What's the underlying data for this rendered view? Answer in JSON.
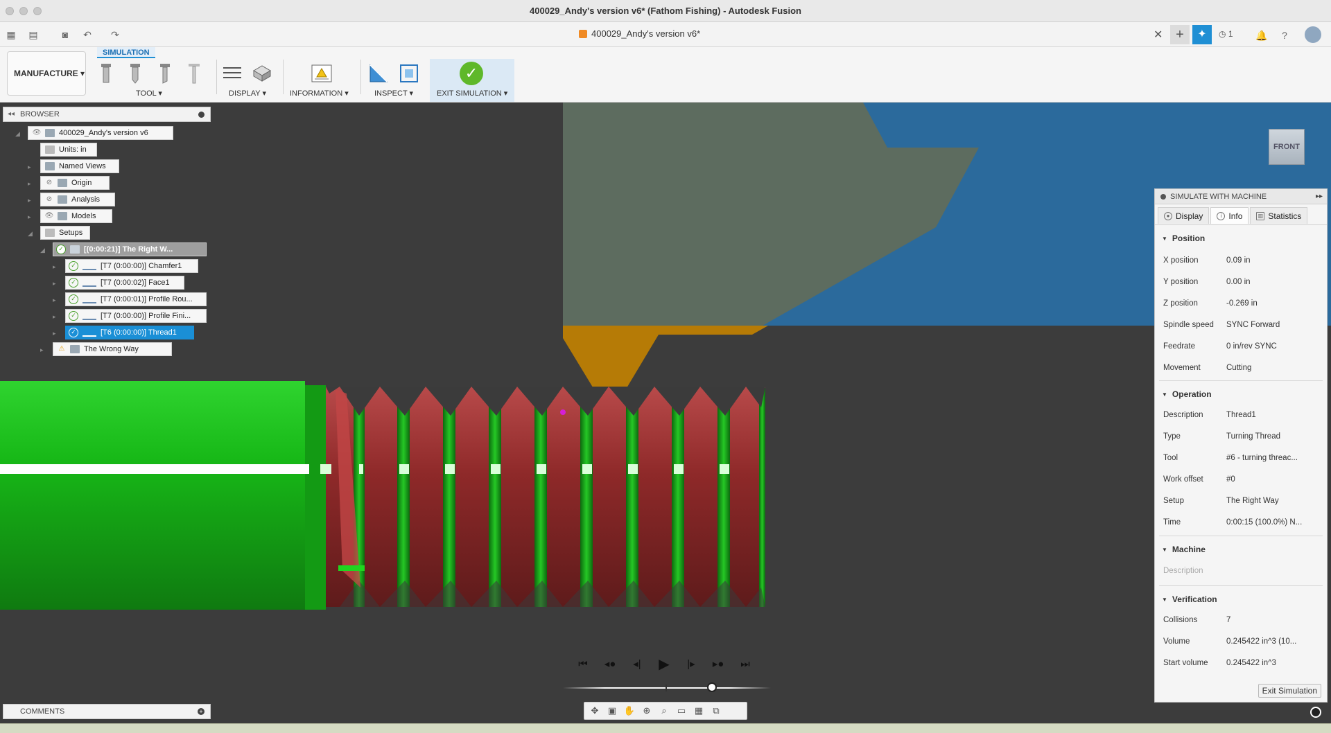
{
  "window": {
    "title": "400029_Andy's version v6* (Fathom Fishing) - Autodesk Fusion"
  },
  "tabbar": {
    "doc_tab": "400029_Andy's version v6*",
    "jobs_count": "1"
  },
  "ribbon": {
    "workspace": "MANUFACTURE",
    "active_tab": "SIMULATION",
    "groups": {
      "tool": "TOOL",
      "display": "DISPLAY",
      "information": "INFORMATION",
      "inspect": "INSPECT",
      "exit_simulation": "EXIT SIMULATION"
    }
  },
  "browser": {
    "title": "BROWSER",
    "root": "400029_Andy's version v6",
    "units": "Units: in",
    "named_views": "Named Views",
    "origin": "Origin",
    "analysis": "Analysis",
    "models": "Models",
    "setups": "Setups",
    "setup_right": "[(0:00:21)] The Right W...",
    "ops": [
      "[T7 (0:00:00)] Chamfer1",
      "[T7 (0:00:02)] Face1",
      "[T7 (0:00:01)] Profile Rou...",
      "[T7 (0:00:00)] Profile Fini...",
      "[T6 (0:00:00)] Thread1"
    ],
    "setup_wrong": "The Wrong Way"
  },
  "comments": {
    "title": "COMMENTS"
  },
  "viewcube": {
    "label": "FRONT"
  },
  "sim_panel": {
    "title": "SIMULATE WITH MACHINE",
    "tabs": [
      "Display",
      "Info",
      "Statistics"
    ],
    "position": {
      "title": "Position",
      "rows": [
        {
          "k": "X position",
          "v": "0.09 in"
        },
        {
          "k": "Y position",
          "v": "0.00 in"
        },
        {
          "k": "Z position",
          "v": "-0.269 in"
        },
        {
          "k": "Spindle speed",
          "v": "SYNC Forward"
        },
        {
          "k": "Feedrate",
          "v": "0 in/rev SYNC"
        },
        {
          "k": "Movement",
          "v": "Cutting"
        }
      ]
    },
    "operation": {
      "title": "Operation",
      "rows": [
        {
          "k": "Description",
          "v": "Thread1"
        },
        {
          "k": "Type",
          "v": "Turning Thread"
        },
        {
          "k": "Tool",
          "v": "#6 - turning threac..."
        },
        {
          "k": "Work offset",
          "v": "#0"
        },
        {
          "k": "Setup",
          "v": "The Right Way"
        },
        {
          "k": "Time",
          "v": "0:00:15 (100.0%) N..."
        }
      ]
    },
    "machine": {
      "title": "Machine",
      "description": "Description"
    },
    "verification": {
      "title": "Verification",
      "rows": [
        {
          "k": "Collisions",
          "v": "7"
        },
        {
          "k": "Volume",
          "v": "0.245422 in^3 (10..."
        },
        {
          "k": "Start volume",
          "v": "0.245422 in^3"
        }
      ]
    },
    "exit_button": "Exit Simulation"
  }
}
